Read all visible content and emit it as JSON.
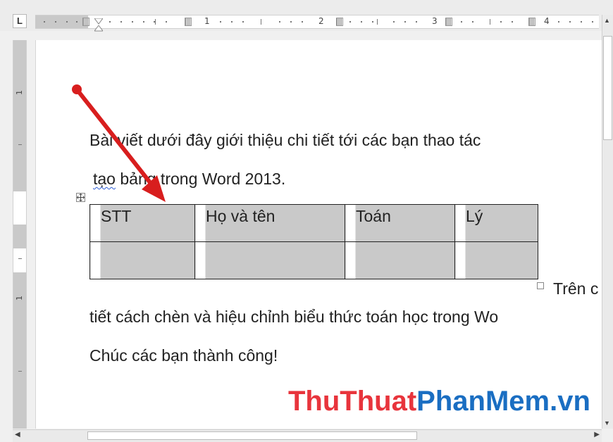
{
  "ruler": {
    "tab_selector": "L",
    "numbers": [
      "1",
      "2",
      "3",
      "4"
    ],
    "vertical_numbers": [
      "1",
      "1"
    ]
  },
  "document": {
    "paragraph1_line1": "Bài viết dưới đây giới thiệu chi tiết tới các bạn thao tác",
    "paragraph1_line2_word": "tạo",
    "paragraph1_line2_rest": " bảng trong Word 2013.",
    "table": {
      "headers": [
        "STT",
        "Họ và tên",
        "Toán",
        "Lý"
      ],
      "rows": [
        [
          "",
          "",
          "",
          ""
        ]
      ]
    },
    "after_table_text": "Trên c",
    "line_3": "tiết cách chèn và hiệu chỉnh biểu thức toán học trong Wo",
    "line_4": "Chúc các bạn thành công!"
  },
  "watermark": {
    "part1": "ThuThuat",
    "part2": "PhanMem",
    "part3": ".vn",
    "colors": {
      "part1": "#e8343c",
      "part2": "#1a6ec2",
      "part3": "#1a6ec2"
    }
  },
  "annotation": {
    "arrow_color": "#d81e1e"
  },
  "icons": {
    "move_handle": "move-icon",
    "resize_handle": "resize-icon",
    "scroll_up": "arrow-up-icon",
    "scroll_left": "arrow-left-icon",
    "scroll_right": "arrow-right-icon"
  }
}
